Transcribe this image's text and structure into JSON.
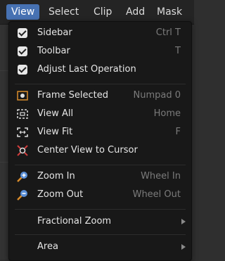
{
  "menubar": {
    "items": [
      {
        "label": "View"
      },
      {
        "label": "Select"
      },
      {
        "label": "Clip"
      },
      {
        "label": "Add"
      },
      {
        "label": "Mask"
      }
    ]
  },
  "menu": {
    "toggles": [
      {
        "label": "Sidebar",
        "shortcut": "Ctrl T",
        "checked": true
      },
      {
        "label": "Toolbar",
        "shortcut": "T",
        "checked": true
      },
      {
        "label": "Adjust Last Operation",
        "shortcut": "",
        "checked": true
      }
    ],
    "view_ops": [
      {
        "label": "Frame Selected",
        "shortcut": "Numpad 0",
        "icon": "frame-selected-icon"
      },
      {
        "label": "View All",
        "shortcut": "Home",
        "icon": "view-all-icon"
      },
      {
        "label": "View Fit",
        "shortcut": "F",
        "icon": "view-fit-icon"
      },
      {
        "label": "Center View to Cursor",
        "shortcut": "",
        "icon": "center-cursor-icon"
      }
    ],
    "zoom": [
      {
        "label": "Zoom In",
        "shortcut": "Wheel In",
        "icon": "zoom-in-icon"
      },
      {
        "label": "Zoom Out",
        "shortcut": "Wheel Out",
        "icon": "zoom-out-icon"
      }
    ],
    "submenus": [
      {
        "label": "Fractional Zoom"
      },
      {
        "label": "Area"
      }
    ]
  },
  "colors": {
    "active_menu": "#4772b3",
    "menu_bg": "#181818",
    "shortcut_text": "#7b7b7b",
    "zoom_icon_blue": "#5b8fd6",
    "center_cursor_red": "#d23c3c"
  }
}
